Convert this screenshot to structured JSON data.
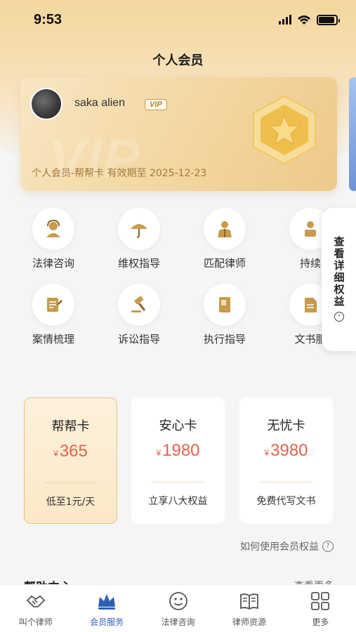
{
  "status_bar": {
    "time": "9:53",
    "battery_level": 0.9
  },
  "header": {
    "title": "个人会员"
  },
  "member_card": {
    "username": "saka alien",
    "vip_badge": "VIP",
    "watermark": "VIP",
    "description": "个人会员-帮帮卡  有效期至  2025-12-23"
  },
  "services": [
    {
      "label": "法律咨询",
      "icon": "consult-icon"
    },
    {
      "label": "维权指导",
      "icon": "umbrella-icon"
    },
    {
      "label": "匹配律师",
      "icon": "lawyer-icon"
    },
    {
      "label": "持续",
      "icon": "continuous-icon"
    },
    {
      "label": "案情梳理",
      "icon": "case-icon"
    },
    {
      "label": "诉讼指导",
      "icon": "gavel-icon"
    },
    {
      "label": "执行指导",
      "icon": "book-icon"
    },
    {
      "label": "文书服",
      "icon": "document-icon"
    }
  ],
  "detail_tab": {
    "label": "查看详细权益"
  },
  "plans": [
    {
      "name": "帮帮卡",
      "currency": "¥",
      "price": "365",
      "note": "低至1元/天",
      "active": true
    },
    {
      "name": "安心卡",
      "currency": "¥",
      "price": "1980",
      "note": "立享八大权益",
      "active": false
    },
    {
      "name": "无忧卡",
      "currency": "¥",
      "price": "3980",
      "note": "免费代写文书",
      "active": false
    }
  ],
  "howto": {
    "label": "如何使用会员权益",
    "icon": "question-icon"
  },
  "help": {
    "title": "帮助中心",
    "more": "查看更多"
  },
  "tabbar": [
    {
      "label": "叫个律师",
      "icon": "handshake-icon",
      "active": false
    },
    {
      "label": "会员服务",
      "icon": "crown-icon",
      "active": true
    },
    {
      "label": "法律咨询",
      "icon": "smile-icon",
      "active": false
    },
    {
      "label": "律师资源",
      "icon": "open-book-icon",
      "active": false
    },
    {
      "label": "更多",
      "icon": "grid-icon",
      "active": false
    }
  ],
  "colors": {
    "accent": "#e0634e",
    "gold": "#c89a4c",
    "tab_active": "#2f5fb5"
  }
}
